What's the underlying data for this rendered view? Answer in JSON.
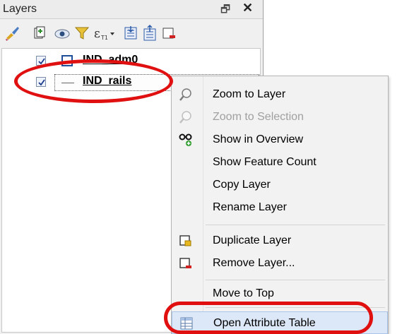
{
  "panel": {
    "title": "Layers",
    "float_glyph": "🗗",
    "close_glyph": "✕"
  },
  "toolbar": {
    "icons": [
      "style-brush-icon",
      "add-group-icon",
      "eye-icon",
      "filter-icon",
      "expression-filter-icon",
      "expand-all-icon",
      "collapse-all-icon",
      "remove-layer-icon"
    ]
  },
  "layers": [
    {
      "name": "IND_adm0",
      "checked": true,
      "symbol": "polygon",
      "symbol_color": "#1f4e9a"
    },
    {
      "name": "IND_rails",
      "checked": true,
      "symbol": "line",
      "symbol_color": "#666666"
    }
  ],
  "context_menu": {
    "items": [
      {
        "label": "Zoom to Layer",
        "icon": "zoom-icon",
        "enabled": true
      },
      {
        "label": "Zoom to Selection",
        "icon": "zoom-icon",
        "enabled": false
      },
      {
        "label": "Show in Overview",
        "icon": "glasses-plus-icon",
        "enabled": true
      },
      {
        "label": "Show Feature Count",
        "icon": "",
        "enabled": true
      },
      {
        "label": "Copy Layer",
        "icon": "",
        "enabled": true
      },
      {
        "label": "Rename Layer",
        "icon": "",
        "enabled": true
      },
      {
        "label": "Duplicate Layer",
        "icon": "duplicate-layer-icon",
        "enabled": true
      },
      {
        "label": "Remove Layer...",
        "icon": "remove-layer-icon",
        "enabled": true
      },
      {
        "label": "Move to Top",
        "icon": "",
        "enabled": true
      },
      {
        "label": "Open Attribute Table",
        "icon": "table-icon",
        "enabled": true,
        "highlighted": true
      }
    ]
  },
  "colors": {
    "highlight_ring": "#e01010",
    "menu_highlight": "#dce8f7"
  }
}
